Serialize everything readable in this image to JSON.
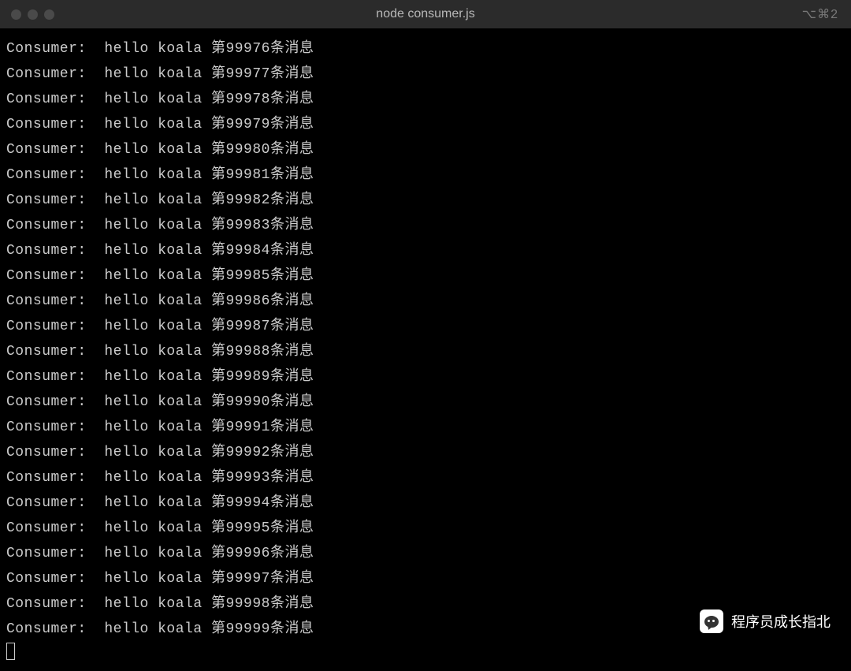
{
  "window": {
    "title": "node consumer.js",
    "shortcut": "⌥⌘2"
  },
  "terminal": {
    "prefix": "Consumer:  hello koala 第",
    "suffix": "条消息",
    "lines": [
      {
        "num": "99976"
      },
      {
        "num": "99977"
      },
      {
        "num": "99978"
      },
      {
        "num": "99979"
      },
      {
        "num": "99980"
      },
      {
        "num": "99981"
      },
      {
        "num": "99982"
      },
      {
        "num": "99983"
      },
      {
        "num": "99984"
      },
      {
        "num": "99985"
      },
      {
        "num": "99986"
      },
      {
        "num": "99987"
      },
      {
        "num": "99988"
      },
      {
        "num": "99989"
      },
      {
        "num": "99990"
      },
      {
        "num": "99991"
      },
      {
        "num": "99992"
      },
      {
        "num": "99993"
      },
      {
        "num": "99994"
      },
      {
        "num": "99995"
      },
      {
        "num": "99996"
      },
      {
        "num": "99997"
      },
      {
        "num": "99998"
      },
      {
        "num": "99999"
      }
    ]
  },
  "watermark": {
    "text": "程序员成长指北"
  }
}
